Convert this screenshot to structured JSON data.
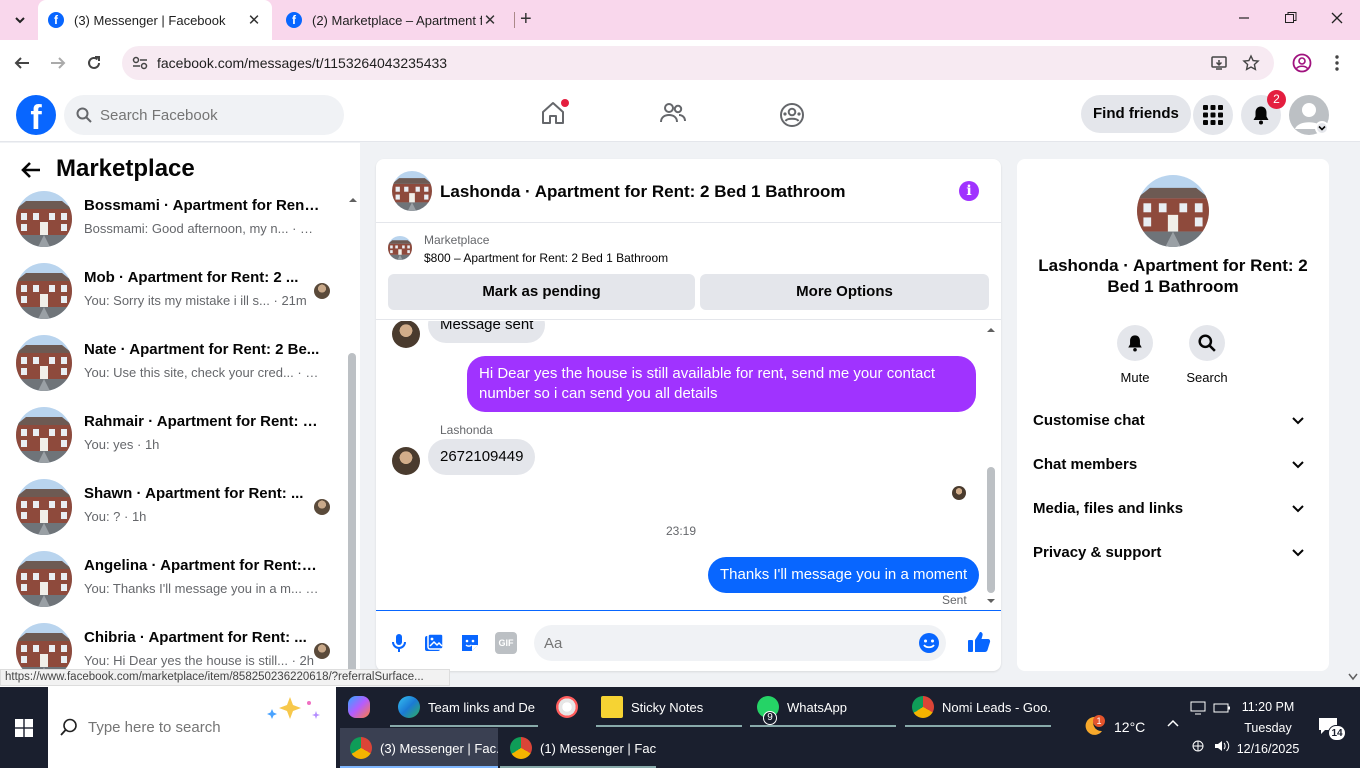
{
  "browser": {
    "tabs": [
      {
        "title": "(3) Messenger | Facebook"
      },
      {
        "title": "(2) Marketplace – Apartment fo"
      }
    ],
    "url": "facebook.com/messages/t/1153264043235433",
    "status_link": "https://www.facebook.com/marketplace/item/858250236220618/?referralSurface..."
  },
  "facebook": {
    "logo": "f",
    "search_placeholder": "Search Facebook",
    "find_friends": "Find friends",
    "notif_count": "2"
  },
  "sidebar": {
    "title": "Marketplace",
    "conversations": [
      {
        "title": "Bossmami · Apartment for Rent:...",
        "preview": "Bossmami: Good afternoon, my n... · 20m",
        "has_avatar": false
      },
      {
        "title": "Mob · Apartment for Rent: 2 ...",
        "preview": "You: Sorry its my mistake i ill s... · 21m",
        "has_avatar": true
      },
      {
        "title": "Nate · Apartment for Rent: 2 Be...",
        "preview": "You: Use this site, check your cred... · 59m",
        "has_avatar": false
      },
      {
        "title": "Rahmair · Apartment for Rent: 2...",
        "preview": "You: yes · 1h",
        "has_avatar": false
      },
      {
        "title": "Shawn · Apartment for Rent: ...",
        "preview": "You: ? · 1h",
        "has_avatar": true
      },
      {
        "title": "Angelina · Apartment for Rent: 2...",
        "preview": "You: Thanks I'll message you in a m... · 2h",
        "has_avatar": false
      },
      {
        "title": "Chibria · Apartment for Rent: ...",
        "preview": "You: Hi Dear yes the house is still... · 2h",
        "has_avatar": true
      }
    ]
  },
  "chat": {
    "title": "Lashonda · Apartment for Rent: 2 Bed 1 Bathroom",
    "marketplace_label": "Marketplace",
    "listing": "$800 – Apartment for Rent: 2 Bed 1 Bathroom",
    "mark_pending": "Mark as pending",
    "more_options": "More Options",
    "messages": {
      "partial": "Message sent",
      "out1": "Hi Dear yes the house is still available for rent, send me your contact number so i can send you all details",
      "sender": "Lashonda",
      "in1": "2672109449",
      "time": "23:19",
      "out2": "Thanks I'll message you in a moment",
      "status": "Sent"
    },
    "composer_placeholder": "Aa",
    "gif_label": "GIF"
  },
  "details": {
    "name": "Lashonda · Apartment for Rent: 2 Bed 1 Bathroom",
    "actions": [
      "Mute",
      "Search"
    ],
    "sections": [
      "Customise chat",
      "Chat members",
      "Media, files and links",
      "Privacy & support"
    ]
  },
  "taskbar": {
    "search_placeholder": "Type here to search",
    "apps_top": [
      {
        "label": "Team links and De..."
      },
      {
        "label": "Sticky Notes"
      },
      {
        "label": "WhatsApp"
      },
      {
        "label": "Nomi Leads - Goo..."
      }
    ],
    "apps_bottom": [
      {
        "label": "(3) Messenger | Fac..."
      },
      {
        "label": "(1) Messenger | Fac..."
      }
    ],
    "whatsapp_badge": "9",
    "weather_badge": "1",
    "temperature": "12°C",
    "time": "11:20 PM",
    "day": "Tuesday",
    "date": "12/16/2025",
    "notification_count": "14"
  },
  "colors": {
    "fb_blue": "#0866ff",
    "outgoing_purple": "#a033ff",
    "outgoing_blue": "#0866ff",
    "tabbar_pink": "#f9d7ec"
  }
}
